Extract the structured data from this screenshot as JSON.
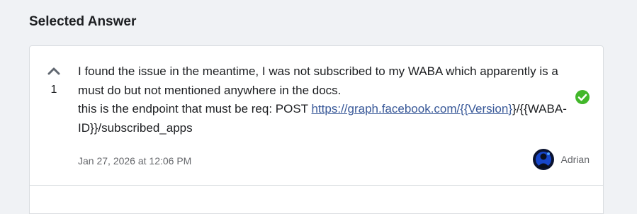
{
  "section": {
    "title": "Selected Answer"
  },
  "answer": {
    "votes": "1",
    "line1": "I found the issue in the meantime, I was not subscribed to my WABA which apparently is a must do but not mentioned anywhere in the docs.",
    "line2_prefix": "this is the endpoint that must be req: POST ",
    "link_text": "https://graph.facebook.com/{{Version}",
    "line2_suffix": "}/{{WABA-ID}}/subscribed_apps",
    "accepted": true,
    "timestamp": "Jan 27, 2026 at 12:06 PM",
    "author": "Adrian"
  },
  "icons": {
    "upvote": "chevron-up-icon",
    "accepted": "check-circle-icon"
  },
  "colors": {
    "background": "#f0f2f5",
    "card": "#ffffff",
    "link": "#385898",
    "accepted": "#42b72a",
    "muted_text": "#65676b"
  }
}
